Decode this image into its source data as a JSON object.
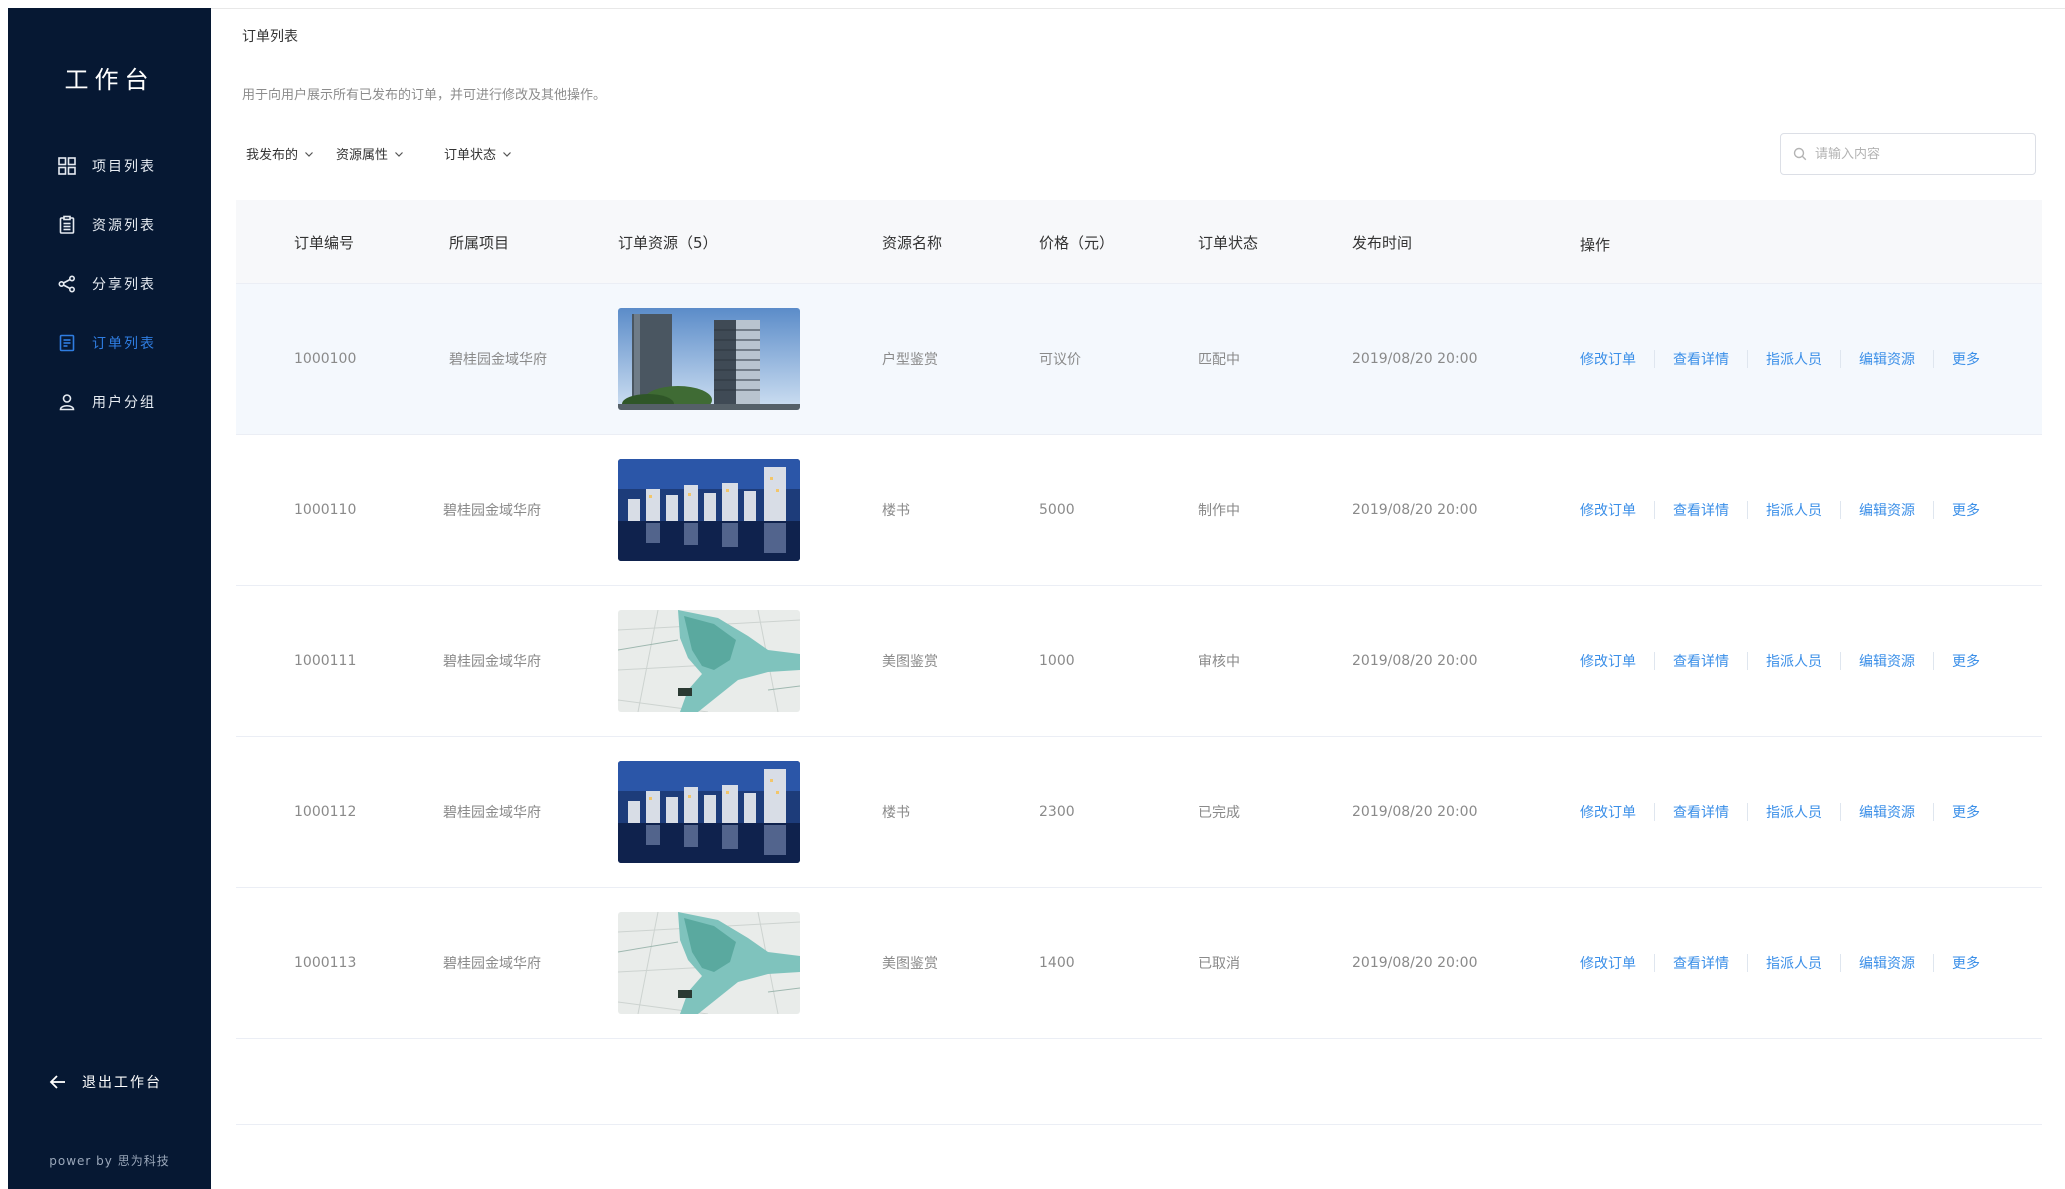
{
  "sidebar": {
    "brand": "工作台",
    "items": [
      {
        "label": "项目列表",
        "icon": "grid-icon",
        "active": false
      },
      {
        "label": "资源列表",
        "icon": "clipboard-icon",
        "active": false
      },
      {
        "label": "分享列表",
        "icon": "share-icon",
        "active": false
      },
      {
        "label": "订单列表",
        "icon": "document-icon",
        "active": true
      },
      {
        "label": "用户分组",
        "icon": "user-icon",
        "active": false
      }
    ],
    "logout_label": "退出工作台",
    "powered_by": "power by 思为科技"
  },
  "page": {
    "title": "订单列表",
    "description": "用于向用户展示所有已发布的订单，并可进行修改及其他操作。"
  },
  "filters": [
    {
      "label": "我发布的"
    },
    {
      "label": "资源属性"
    },
    {
      "label": "订单状态"
    }
  ],
  "search": {
    "placeholder": "请输入内容",
    "value": ""
  },
  "table": {
    "headers": {
      "order_id": "订单编号",
      "project": "所属项目",
      "resource": "订单资源（5）",
      "resource_name": "资源名称",
      "price": "价格（元）",
      "status": "订单状态",
      "publish_time": "发布时间",
      "actions": "操作"
    },
    "actions": [
      "修改订单",
      "查看详情",
      "指派人员",
      "编辑资源",
      "更多"
    ],
    "rows": [
      {
        "order_id": "1000100",
        "project": "碧桂园金域华府",
        "thumb": "tower",
        "resource_name": "户型鉴赏",
        "price": "可议价",
        "status": "匹配中",
        "publish_time": "2019/08/20 20:00"
      },
      {
        "order_id": "1000110",
        "project": "碧桂园金域华府",
        "thumb": "night-city",
        "resource_name": "楼书",
        "price": "5000",
        "status": "制作中",
        "publish_time": "2019/08/20 20:00"
      },
      {
        "order_id": "1000111",
        "project": "碧桂园金域华府",
        "thumb": "map",
        "resource_name": "美图鉴赏",
        "price": "1000",
        "status": "审核中",
        "publish_time": "2019/08/20 20:00"
      },
      {
        "order_id": "1000112",
        "project": "碧桂园金域华府",
        "thumb": "night-city",
        "resource_name": "楼书",
        "price": "2300",
        "status": "已完成",
        "publish_time": "2019/08/20 20:00"
      },
      {
        "order_id": "1000113",
        "project": "碧桂园金域华府",
        "thumb": "map",
        "resource_name": "美图鉴赏",
        "price": "1400",
        "status": "已取消",
        "publish_time": "2019/08/20 20:00"
      }
    ]
  },
  "colors": {
    "sidebar_bg": "#061833",
    "accent": "#3b8fe8",
    "active_nav": "#2f7de1",
    "row_highlight": "#f4f8fd"
  }
}
